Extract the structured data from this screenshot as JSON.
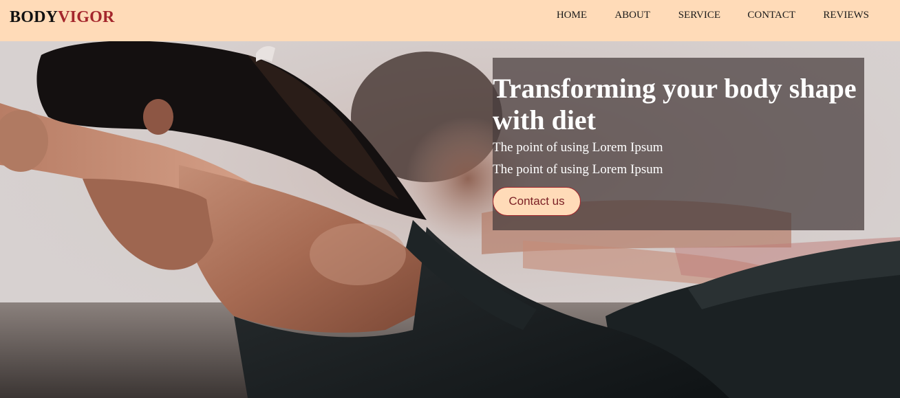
{
  "brand": {
    "part1": "BODY",
    "part2": "VIGOR"
  },
  "nav": {
    "items": [
      {
        "label": "HOME"
      },
      {
        "label": "ABOUT"
      },
      {
        "label": "SERVICE"
      },
      {
        "label": "CONTACT"
      },
      {
        "label": "REVIEWS"
      }
    ]
  },
  "hero": {
    "headline": "Transforming your body shape with diet",
    "lines": [
      "The point of using Lorem Ipsum",
      "The point of using Lorem Ipsum"
    ],
    "cta_label": "Contact us"
  },
  "colors": {
    "navbar_bg": "#ffdbb8",
    "brand_accent": "#a4262c",
    "overlay_bg": "rgba(70,60,60,0.72)",
    "cta_bg": "#ffdbb8"
  }
}
